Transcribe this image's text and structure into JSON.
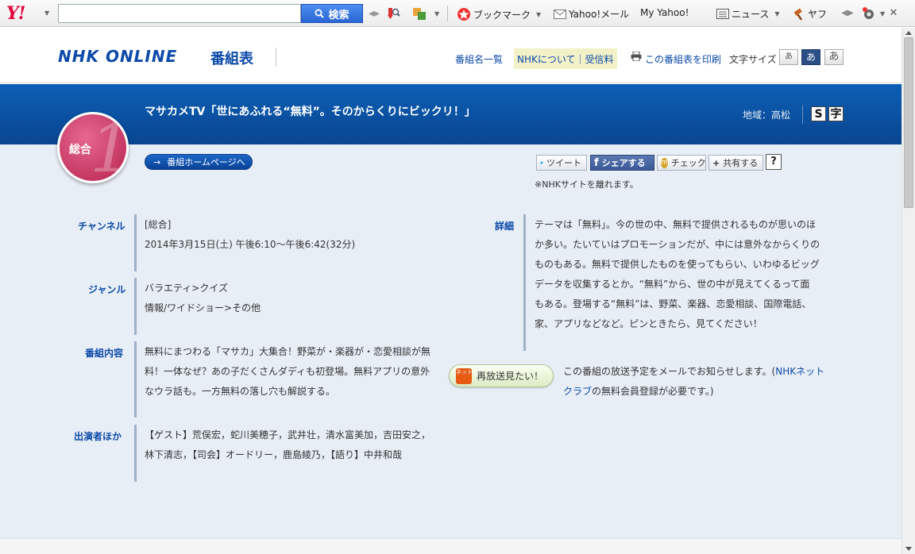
{
  "toolbar": {
    "logo": "Y!",
    "search_button": "検索",
    "bookmark": "ブックマーク",
    "yahoo_mail": "Yahoo!メール",
    "my_yahoo": "My Yahoo!",
    "news": "ニュース",
    "auction": "ヤフ"
  },
  "header": {
    "logo": "NHK ONLINE",
    "logo_sub": "番組表",
    "program_list": "番組名一覧",
    "about_fee": "NHKについて｜受信料",
    "print": "この番組表を印刷",
    "font_size_label": "文字サイズ",
    "font_sizes": [
      "あ",
      "あ",
      "あ"
    ]
  },
  "program": {
    "title": "マサカメTV「世にあふれる“無料”。そのからくりにビックリ！」",
    "region": "地域：高松",
    "badges": [
      "S",
      "字"
    ],
    "channel_badge": "総合",
    "channel_number": "1",
    "home_button": "番組ホームページへ"
  },
  "share": {
    "tweet": "ツイート",
    "facebook": "シェアする",
    "mixi": "チェック",
    "share_more": "共有する",
    "help": "?",
    "note": "※NHKサイトを離れます。"
  },
  "details": {
    "channel_label": "チャンネル",
    "channel_value": "[総合]",
    "datetime": "2014年3月15日(土) 午後6:10～午後6:42(32分)",
    "genre_label": "ジャンル",
    "genres": [
      "バラエティ>クイズ",
      "情報/ワイドショー>その他"
    ],
    "content_label": "番組内容",
    "content_lines": [
      "無料にまつわる「マサカ」大集合！野菜が・楽器が・恋愛相談が無",
      "料！一体なぜ？あの子だくさんダディも初登場。無料アプリの意外",
      "なウラ話も。一方無料の落し穴も解説する。"
    ],
    "cast_label": "出演者ほか",
    "cast_lines": [
      "【ゲスト】荒俣宏，蛇川美穂子，武井壮，清水富美加，吉田安之，",
      "林下清志，【司会】オードリー，鹿島綾乃，【語り】中井和哉"
    ],
    "detail_label": "詳細",
    "detail_lines": [
      "テーマは「無料」。今の世の中、無料で提供されるものが思いのほ",
      "か多い。たいていはプロモーションだが、中には意外なからくりの",
      "ものもある。無料で提供したものを使ってもらい、いわゆるビッグ",
      "データを収集するとか。“無料”から、世の中が見えてくるって面",
      "もある。登場する“無料”は、野菜、楽器、恋愛相談、国際電話、",
      "家、アプリなどなど。ピンときたら、見てください！"
    ]
  },
  "rebroadcast": {
    "icon_text": "ネット クラブ",
    "button": "再放送見たい！",
    "note_before": "この番組の放送予定をメールでお知らせします。(",
    "note_link": "NHKネットクラブ",
    "note_after": "の無料会員登録が必要です。)"
  },
  "colors": {
    "nhk_blue": "#0b4aa8",
    "band_blue": "#0c5fb5",
    "channel_pink": "#c9335f",
    "content_bg": "#e8eef6"
  }
}
